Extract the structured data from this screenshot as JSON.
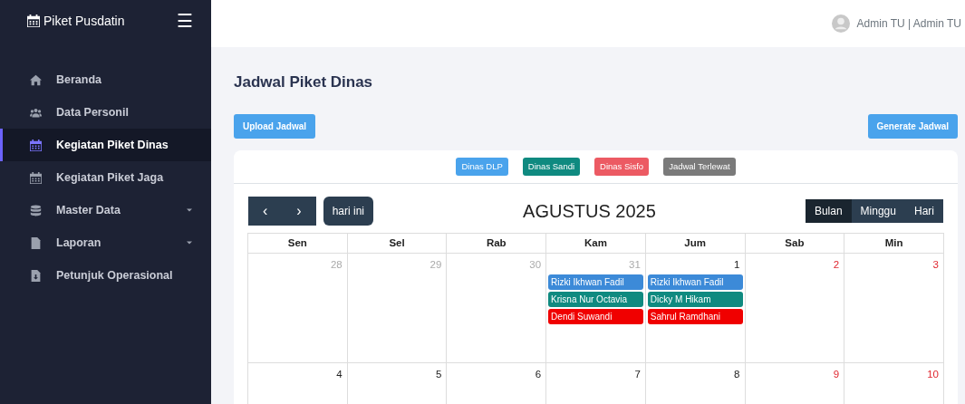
{
  "brand": {
    "title": "Piket Pusdatin",
    "toggle": "☰"
  },
  "sidebar": {
    "items": [
      {
        "label": "Beranda",
        "selected": false,
        "has_submenu": false
      },
      {
        "label": "Data Personil",
        "selected": false,
        "has_submenu": false
      },
      {
        "label": "Kegiatan Piket Dinas",
        "selected": true,
        "has_submenu": false
      },
      {
        "label": "Kegiatan Piket Jaga",
        "selected": false,
        "has_submenu": false
      },
      {
        "label": "Master Data",
        "selected": false,
        "has_submenu": true
      },
      {
        "label": "Laporan",
        "selected": false,
        "has_submenu": true
      },
      {
        "label": "Petunjuk Operasional",
        "selected": false,
        "has_submenu": false
      }
    ]
  },
  "user": {
    "name": "Admin TU | Admin TU"
  },
  "page": {
    "title": "Jadwal Piket Dinas",
    "buttons": [
      {
        "label": "Upload Jadwal"
      },
      {
        "label": "Generate Jadwal"
      }
    ]
  },
  "legend": [
    {
      "label": "Dinas DLP",
      "color": "#4aa3ec"
    },
    {
      "label": "Dinas Sandi",
      "color": "#0f8a80"
    },
    {
      "label": "Dinas Sisfo",
      "color": "#ec5a63"
    },
    {
      "label": "Jadwal Terlewat",
      "color": "#7a7a7a"
    }
  ],
  "calendar": {
    "prev": "‹",
    "next": "›",
    "today": "hari ini",
    "title": "AGUSTUS 2025",
    "views": [
      {
        "label": "Bulan",
        "selected": true
      },
      {
        "label": "Minggu",
        "selected": false
      },
      {
        "label": "Hari",
        "selected": false
      }
    ],
    "weekdays": [
      "Sen",
      "Sel",
      "Rab",
      "Kam",
      "Jum",
      "Sab",
      "Min"
    ],
    "weeks": [
      [
        {
          "day": "28",
          "kind": "other"
        },
        {
          "day": "29",
          "kind": "other"
        },
        {
          "day": "30",
          "kind": "other"
        },
        {
          "day": "31",
          "kind": "other",
          "events": [
            {
              "title": "Rizki Ikhwan Fadil",
              "color": "#3c8ad8"
            },
            {
              "title": "Krisna Nur Octavia",
              "color": "#0f8a80"
            },
            {
              "title": "Dendi Suwandi",
              "color": "#f00000"
            }
          ]
        },
        {
          "day": "1",
          "kind": "weekday",
          "events": [
            {
              "title": "Rizki Ikhwan Fadil",
              "color": "#3c8ad8"
            },
            {
              "title": "Dicky M Hikam",
              "color": "#0f8a80"
            },
            {
              "title": "Sahrul Ramdhani",
              "color": "#f00000"
            }
          ]
        },
        {
          "day": "2",
          "kind": "weekend"
        },
        {
          "day": "3",
          "kind": "weekend"
        }
      ],
      [
        {
          "day": "4",
          "kind": "weekday"
        },
        {
          "day": "5",
          "kind": "weekday"
        },
        {
          "day": "6",
          "kind": "weekday"
        },
        {
          "day": "7",
          "kind": "weekday"
        },
        {
          "day": "8",
          "kind": "weekday"
        },
        {
          "day": "9",
          "kind": "weekend"
        },
        {
          "day": "10",
          "kind": "weekend"
        }
      ]
    ]
  }
}
